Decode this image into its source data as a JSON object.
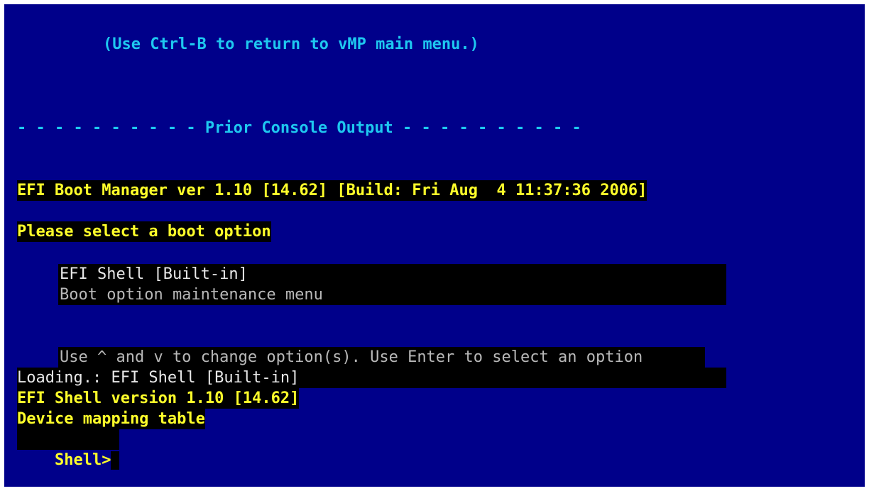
{
  "console": {
    "hint": "(Use Ctrl-B to return to vMP main menu.)",
    "divider": "- - - - - - - - - - Prior Console Output - - - - - - - - - -",
    "boot_manager_header": "EFI Boot Manager ver 1.10 [14.62] [Build: Fri Aug  4 11:37:36 2006]",
    "select_prompt": "Please select a boot option",
    "menu_options": [
      "EFI Shell [Built-in]",
      "Boot option maintenance menu"
    ],
    "instructions": "Use ^ and v to change option(s). Use Enter to select an option",
    "loading": "Loading.: EFI Shell [Built-in]",
    "shell_version": "EFI Shell version 1.10 [14.62]",
    "device_mapping": "Device mapping table",
    "shell_prompt": "Shell>"
  },
  "colors": {
    "background": "#00008a",
    "accent_cyan": "#1ec8f0",
    "highlight_yellow": "#ffff2a",
    "text_white": "#e8e8e8",
    "text_gray": "#b8b8b8"
  }
}
